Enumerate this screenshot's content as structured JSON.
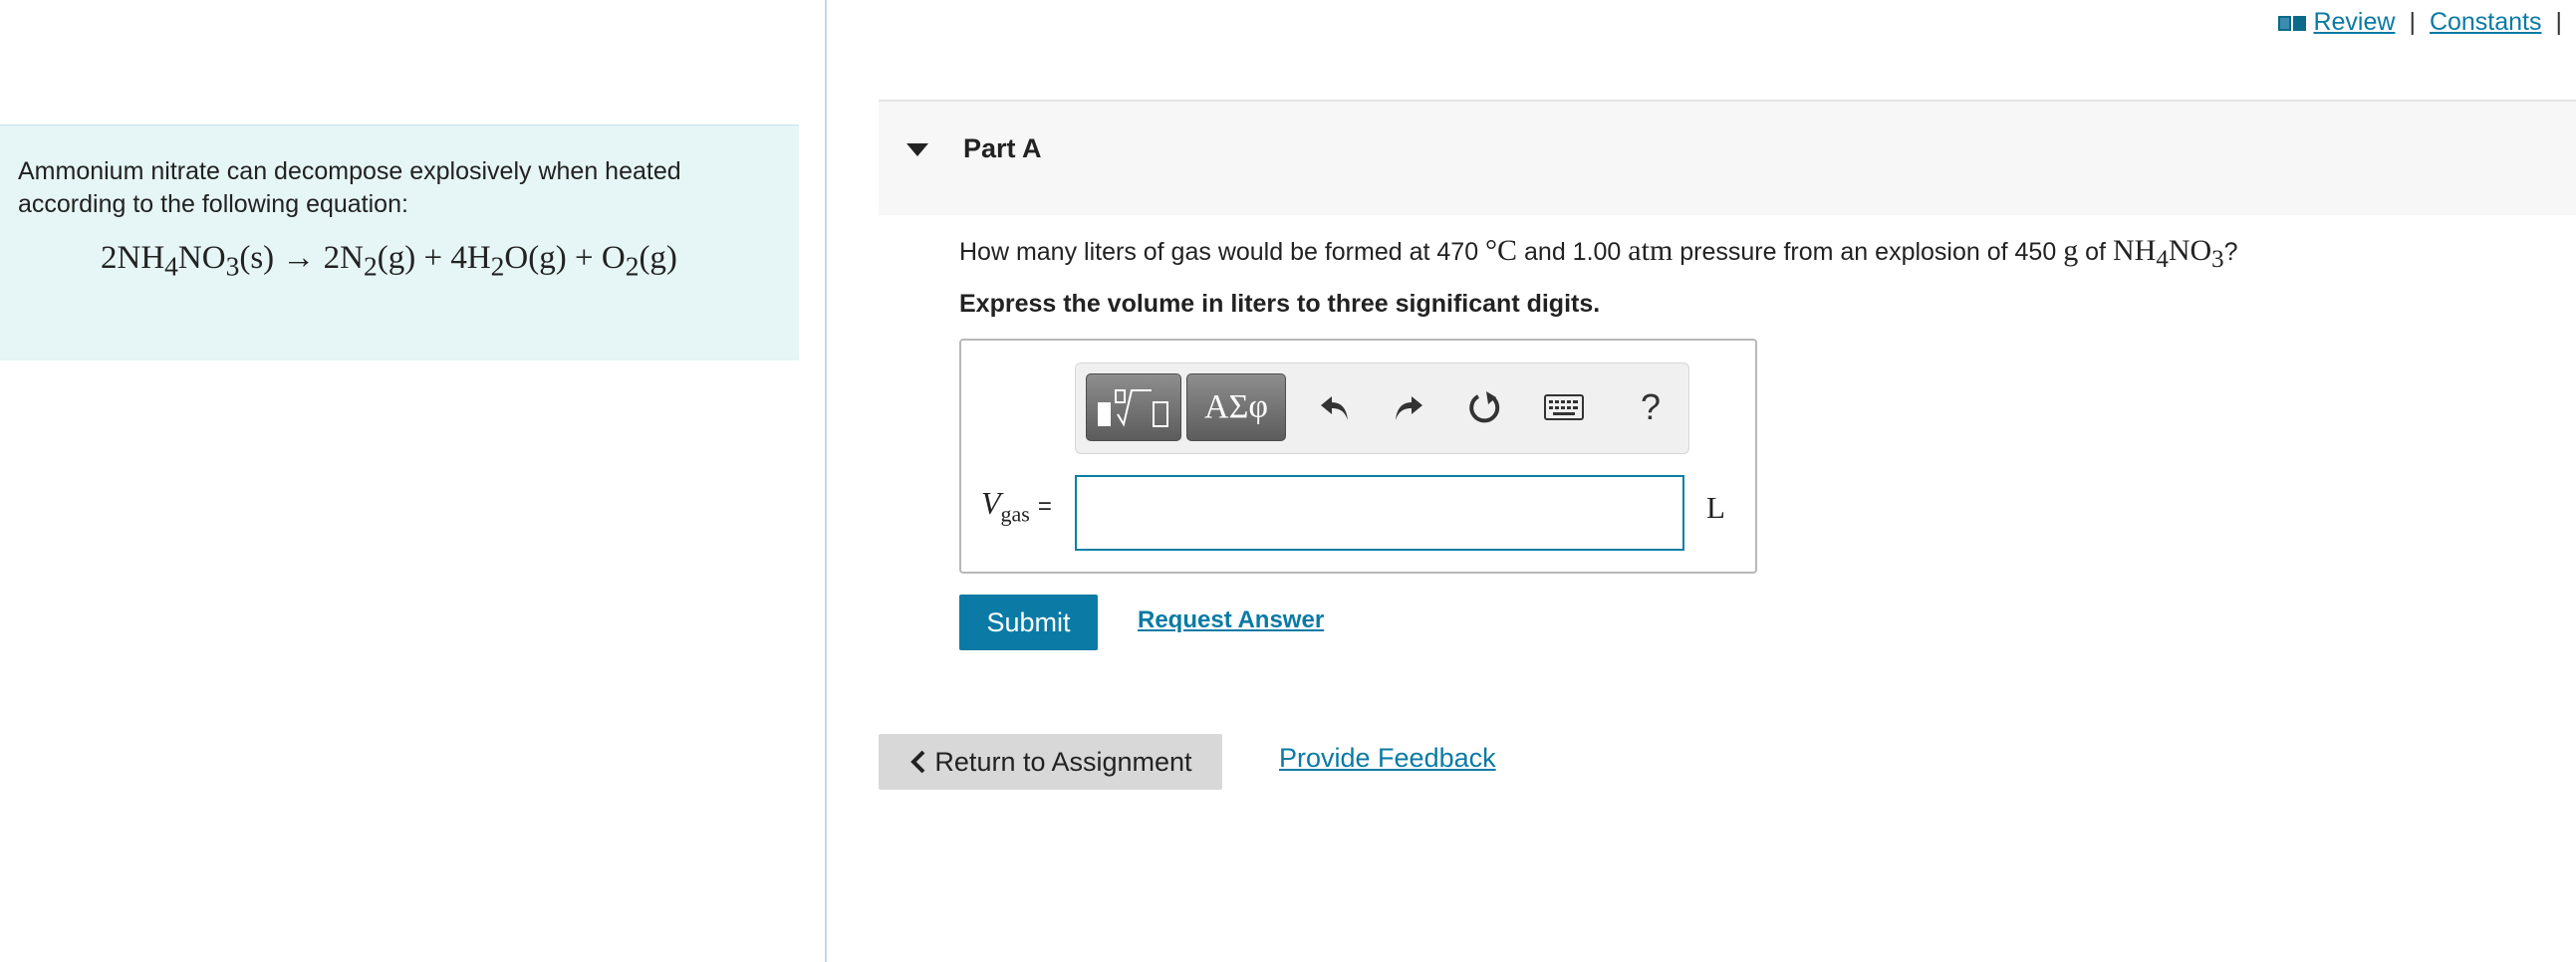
{
  "problem": {
    "intro": "Ammonium nitrate can decompose explosively when heated according to the following equation:",
    "equation_html": "2NH<sub>4</sub>NO<sub>3</sub>(s) → 2N<sub>2</sub>(g) + 4H<sub>2</sub>O(g) + O<sub>2</sub>(g)"
  },
  "top_links": {
    "review": "Review",
    "separator": "|",
    "constants": "Constants",
    "separator2": "|"
  },
  "part": {
    "title": "Part A",
    "question_prefix": "How many liters of gas would be formed at 470",
    "temp_unit": "°C",
    "question_mid": "and 1.00",
    "pressure_unit": "atm",
    "question_mid2": "pressure from an explosion of 450",
    "mass_unit": "g",
    "question_mid3": "of",
    "compound_html": "NH<sub>4</sub>NO<sub>3</sub>",
    "question_suffix": "?",
    "instruction": "Express the volume in liters to three significant digits."
  },
  "toolbar": {
    "symbols_label": "ΑΣφ",
    "help_label": "?"
  },
  "answer": {
    "variable": "V",
    "variable_sub": "gas",
    "equals": "=",
    "value": "",
    "unit": "L"
  },
  "buttons": {
    "submit": "Submit",
    "request_answer": "Request Answer",
    "return": "Return to Assignment",
    "feedback": "Provide Feedback"
  },
  "colors": {
    "accent": "#0b7ba6",
    "panel_bg": "#e6f5f6",
    "link": "#0a7aa5"
  }
}
